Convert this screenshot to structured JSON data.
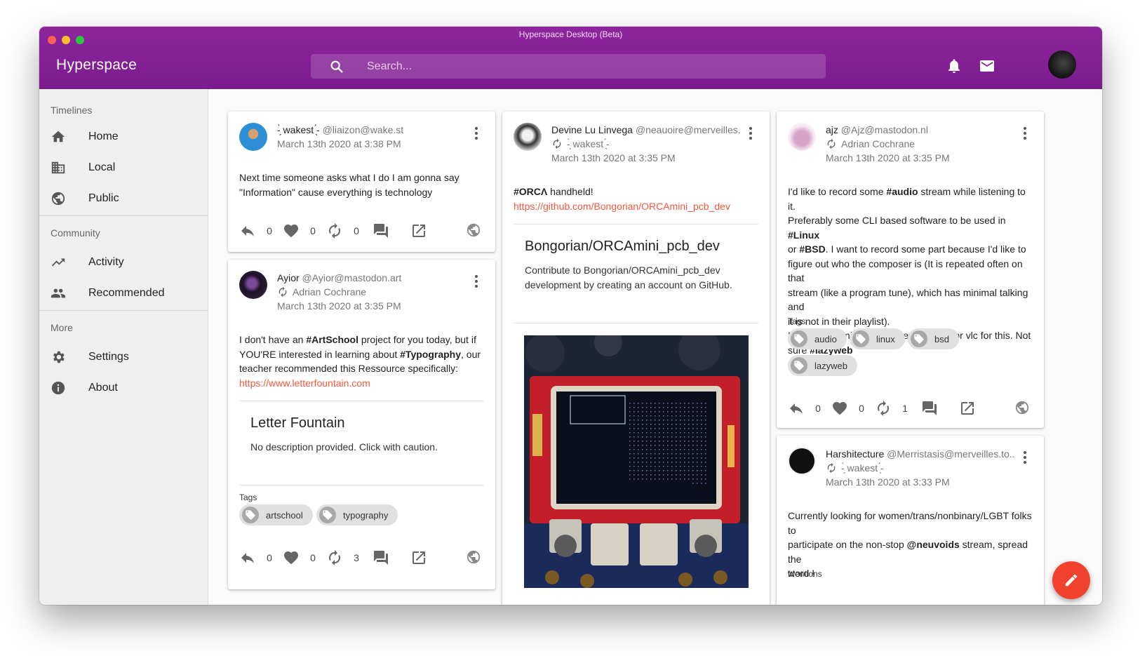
{
  "window": {
    "title": "Hyperspace Desktop (Beta)"
  },
  "appbar": {
    "brand": "Hyperspace",
    "search_placeholder": "Search..."
  },
  "sidebar": {
    "timelines_label": "Timelines",
    "home": "Home",
    "local": "Local",
    "public": "Public",
    "community_label": "Community",
    "activity": "Activity",
    "recommended": "Recommended",
    "more_label": "More",
    "settings": "Settings",
    "about": "About"
  },
  "posts": {
    "p1": {
      "name": "-̗̀ wakest ̖́-",
      "acct": "@liaizon@wake.st",
      "date": "March 13th 2020 at 3:38 PM",
      "line1": "Next time someone asks what I do I am gonna say",
      "line2": "\"Information\" cause everything is technology",
      "replies": "0",
      "favs": "0",
      "boosts": "0"
    },
    "p2": {
      "name": "Ayior",
      "acct": "@Ayior@mastodon.art",
      "boosted_by": "Adrian Cochrane",
      "date": "March 13th 2020 at 3:35 PM",
      "t1": "I don't have an ",
      "tag1": "#ArtSchool",
      "t2": " project for you today, but if",
      "t3": "YOU'RE interested in learning about ",
      "tag2": "#Typography",
      "t4": ", our",
      "t5": "teacher recommended this Ressource specifically:",
      "link": "https://www.letterfountain.com",
      "preview_title": "Letter Fountain",
      "preview_desc": "No description provided. Click with caution.",
      "tags_label": "Tags",
      "chip1": "artschool",
      "chip2": "typography",
      "replies": "0",
      "favs": "0",
      "boosts": "3"
    },
    "p3": {
      "name": "Devine Lu Linvega",
      "acct": "@neauoire@merveilles...",
      "boosted_by": "-̗̀ wakest ̖́-",
      "date": "March 13th 2020 at 3:35 PM",
      "tag": "#ORCΛ",
      "text": " handheld!",
      "link": "https://github.com/Bongorian/ORCAmini_pcb_dev",
      "preview_title": "Bongorian/ORCAmini_pcb_dev",
      "preview_l1": "Contribute to Bongorian/ORCAmini_pcb_dev",
      "preview_l2": "development by creating an account on GitHub."
    },
    "p4": {
      "name": "ajz",
      "acct": "@Ajz@mastodon.nl",
      "boosted_by": "Adrian Cochrane",
      "date": "March 13th 2020 at 3:35 PM",
      "a1": "I'd like to record some ",
      "a1t": "#audio",
      "a1e": " stream while listening to it.",
      "a2": "Preferably some CLI based software to be used in ",
      "a2t": "#Linux",
      "a3": "or ",
      "a3t": "#BSD",
      "a3e": ". I want to record some part because I'd like to",
      "a4": "figure out who the composer is (It is repeated often on that",
      "a5": "stream (like a program tune), which has minimal talking and",
      "a6": "it is not in their playlist).",
      "a7": "In the past I might have used mplayer or vlc for this. Not",
      "a8": "sure ",
      "a8t": "#lazyweb",
      "tags_label": "Tags",
      "chip1": "audio",
      "chip2": "linux",
      "chip3": "bsd",
      "chip4": "lazyweb",
      "replies": "0",
      "favs": "0",
      "boosts": "1"
    },
    "p5": {
      "name": "Harshitecture",
      "acct": "@Merristasis@merveilles.to...",
      "boosted_by": "-̗̀ wakest ̖́-",
      "date": "March 13th 2020 at 3:33 PM",
      "h1": "Currently looking for women/trans/nonbinary/LGBT folks to",
      "h2": "participate on the non-stop ",
      "h2t": "@neuvoids",
      "h2e": " stream, spread the",
      "h3": "word !",
      "mentions_label": "Mentions"
    }
  },
  "colors": {
    "appbar": "#8f259d",
    "link": "#f2583e",
    "fab": "#f2412c"
  }
}
